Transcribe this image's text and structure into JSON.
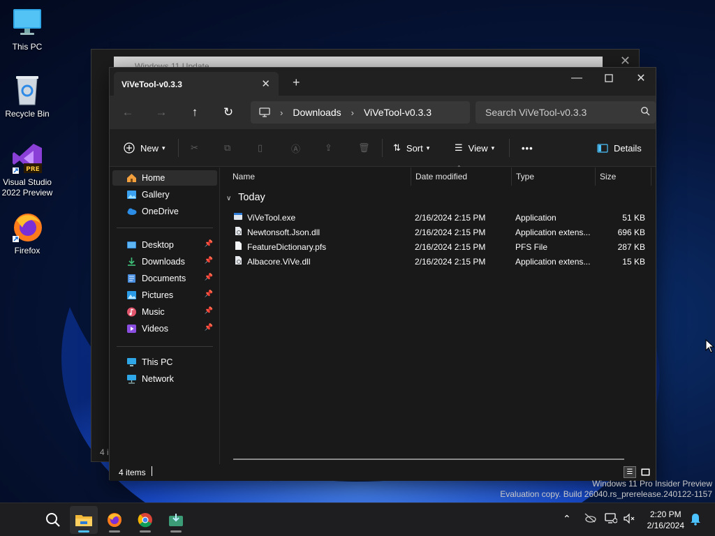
{
  "desktop": {
    "icons": [
      {
        "label": "This PC"
      },
      {
        "label": "Recycle Bin"
      },
      {
        "label": "Visual Studio 2022 Preview",
        "badge": "PRE"
      },
      {
        "label": "Firefox"
      }
    ]
  },
  "background_window": {
    "tab_title": "Windows 11 Update",
    "footer": "4 i"
  },
  "explorer": {
    "tab_title": "ViVeTool-v0.3.3",
    "new_tab": "+",
    "breadcrumb": [
      "Downloads",
      "ViVeTool-v0.3.3"
    ],
    "search_placeholder": "Search ViVeTool-v0.3.3",
    "toolbar": {
      "new_label": "New",
      "sort_label": "Sort",
      "view_label": "View",
      "more_label": "•••",
      "details_label": "Details"
    },
    "sidebar": {
      "top": [
        {
          "label": "Home"
        },
        {
          "label": "Gallery"
        },
        {
          "label": "OneDrive"
        }
      ],
      "pinned": [
        {
          "label": "Desktop"
        },
        {
          "label": "Downloads"
        },
        {
          "label": "Documents"
        },
        {
          "label": "Pictures"
        },
        {
          "label": "Music"
        },
        {
          "label": "Videos"
        }
      ],
      "devices": [
        {
          "label": "This PC"
        },
        {
          "label": "Network"
        }
      ]
    },
    "columns": {
      "name": "Name",
      "date": "Date modified",
      "type": "Type",
      "size": "Size"
    },
    "group_label": "Today",
    "files": [
      {
        "name": "ViVeTool.exe",
        "date": "2/16/2024 2:15 PM",
        "type": "Application",
        "size": "51 KB"
      },
      {
        "name": "Newtonsoft.Json.dll",
        "date": "2/16/2024 2:15 PM",
        "type": "Application extens...",
        "size": "696 KB"
      },
      {
        "name": "FeatureDictionary.pfs",
        "date": "2/16/2024 2:15 PM",
        "type": "PFS File",
        "size": "287 KB"
      },
      {
        "name": "Albacore.ViVe.dll",
        "date": "2/16/2024 2:15 PM",
        "type": "Application extens...",
        "size": "15 KB"
      }
    ],
    "status": "4 items"
  },
  "watermark": {
    "line1": "Windows 11 Pro Insider Preview",
    "line2": "Evaluation copy. Build 26040.rs_prerelease.240122-1157"
  },
  "taskbar": {
    "time": "2:20 PM",
    "date": "2/16/2024"
  },
  "colors": {
    "accent": "#4cc2ff",
    "window_bg": "#191919",
    "toolbar_bg": "#2c2c2c"
  }
}
